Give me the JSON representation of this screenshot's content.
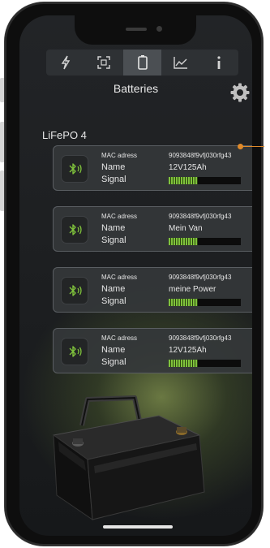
{
  "tabs": [
    {
      "icon": "lightning-icon",
      "glyph": "ϟ",
      "active": false
    },
    {
      "icon": "scan-icon",
      "glyph": "▣",
      "active": false
    },
    {
      "icon": "battery-icon",
      "glyph": "▯",
      "active": true
    },
    {
      "icon": "chart-icon",
      "glyph": "⟋",
      "active": false
    },
    {
      "icon": "info-icon",
      "glyph": "i",
      "active": false
    }
  ],
  "header": {
    "title": "Batteries"
  },
  "group": {
    "label": "LiFePO 4"
  },
  "labels": {
    "mac": "MAC adress",
    "name": "Name",
    "signal": "Signal"
  },
  "batteries": [
    {
      "mac": "9093848f9vfj030rfg43",
      "name": "12V125Ah",
      "signal": 0.4
    },
    {
      "mac": "9093848f9vfj030rfg43",
      "name": "Mein Van",
      "signal": 0.4
    },
    {
      "mac": "9093848f9vfj030rfg43",
      "name": "meine Power",
      "signal": 0.4
    },
    {
      "mac": "9093848f9vfj030rfg43",
      "name": "12V125Ah",
      "signal": 0.4
    }
  ],
  "colors": {
    "accent": "#7fc23c",
    "callout": "#e08a2a"
  }
}
